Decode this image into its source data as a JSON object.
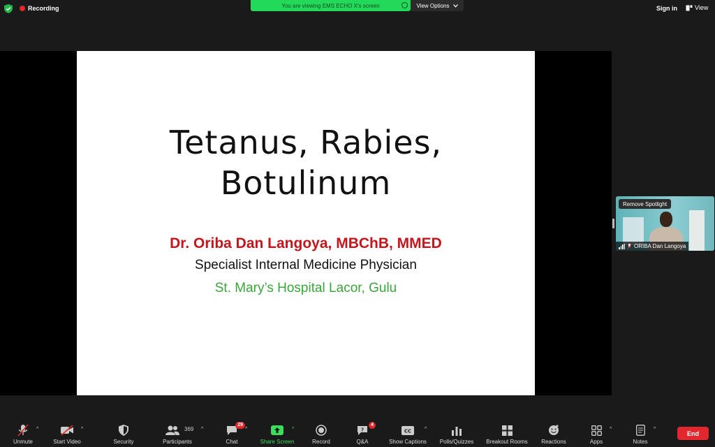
{
  "topbar": {
    "recording": "Recording",
    "viewing_banner": "You are viewing EMS ECHO X's screen",
    "view_options": "View Options",
    "sign_in": "Sign in",
    "view": "View"
  },
  "slide": {
    "title_line1": "Tetanus, Rabies,",
    "title_line2": "Botulinum",
    "author": "Dr. Oriba Dan Langoya, MBChB, MMED",
    "role": "Specialist Internal Medicine Physician",
    "hospital": "St. Mary’s Hospital Lacor, Gulu"
  },
  "thumbnail": {
    "remove_spotlight": "Remove Spotlight",
    "participant_name": "ORIBA Dan Langoya"
  },
  "toolbar": {
    "unmute": "Unmute",
    "start_video": "Start Video",
    "security": "Security",
    "participants": "Participants",
    "participants_count": "369",
    "chat": "Chat",
    "chat_badge": "29",
    "share_screen": "Share Screen",
    "record": "Record",
    "qa": "Q&A",
    "qa_badge": "4",
    "show_captions": "Show Captions",
    "polls": "Polls/Quizzes",
    "breakout": "Breakout Rooms",
    "reactions": "Reactions",
    "apps": "Apps",
    "notes": "Notes",
    "end": "End"
  },
  "colors": {
    "accent_green": "#23d959",
    "end_red": "#e0282e",
    "author_red": "#c4161c",
    "hospital_green": "#3aa53a"
  }
}
